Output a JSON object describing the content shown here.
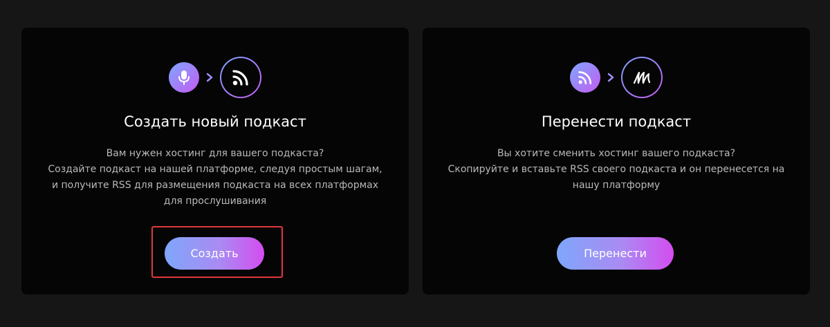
{
  "colors": {
    "background": "#161616",
    "card": "#050505",
    "gradient_start": "#7ea6ff",
    "gradient_end": "#c45cf0",
    "highlight": "#e0393b"
  },
  "create": {
    "icons": [
      "microphone-icon",
      "chevron-right-icon",
      "rss-icon"
    ],
    "title": "Создать новый подкаст",
    "description": [
      "Вам нужен хостинг для вашего подкаста?",
      "Создайте подкаст на нашей платформе, следуя простым шагам,",
      "и получите RSS для размещения подкаста на всех платформах",
      "для прослушивания"
    ],
    "button_label": "Создать"
  },
  "transfer": {
    "icons": [
      "rss-icon",
      "chevron-right-icon",
      "platform-logo-icon"
    ],
    "title": "Перенести подкаст",
    "description": [
      "Вы хотите сменить хостинг вашего подкаста?",
      "Скопируйте и вставьте RSS своего подкаста и он перенесется на",
      "нашу платформу"
    ],
    "button_label": "Перенести"
  }
}
